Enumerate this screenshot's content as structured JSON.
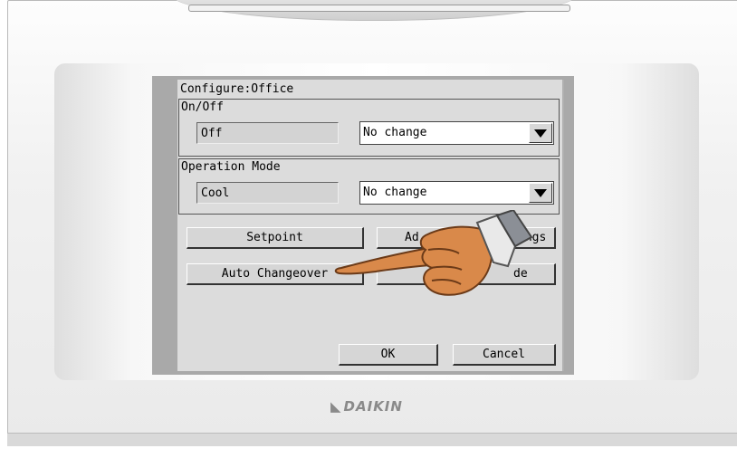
{
  "brand": {
    "logo_text": "DAIKIN"
  },
  "dialog": {
    "title": "Configure:Office",
    "onoff": {
      "group_label": "On/Off",
      "current_value": "Off",
      "select_value": "No change"
    },
    "mode": {
      "group_label": "Operation Mode",
      "current_value": "Cool",
      "select_value": "No change"
    },
    "buttons": {
      "setpoint": "Setpoint",
      "advanced_settings_visible": "Ad",
      "advanced_settings_tail": "ings",
      "auto_changeover": "Auto Changeover",
      "fourth_visible": "de",
      "ok": "OK",
      "cancel": "Cancel"
    }
  },
  "colors": {
    "screen_bg": "#a9a9a9",
    "panel_bg": "#dcdcdc",
    "hand_skin": "#d9894a"
  },
  "icons": {
    "pointer": "pointing-hand-icon",
    "dropdown": "triangle-down-icon"
  }
}
